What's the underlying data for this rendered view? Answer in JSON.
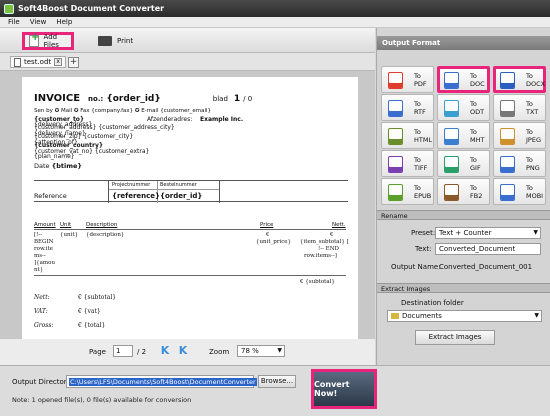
{
  "window": {
    "title": "Soft4Boost Document Converter"
  },
  "menu": [
    "File",
    "View",
    "Help"
  ],
  "toolbar": {
    "add_files": "Add Files",
    "print": "Print"
  },
  "tab": {
    "file_name": "test.odt",
    "close": "x",
    "add": "+"
  },
  "invoice": {
    "title": "INVOICE",
    "no_label": "no.:",
    "order_id": "{order_id}",
    "blad_label": "blad",
    "page_num": "1",
    "page_total": "/ 0",
    "sent_by": "Sen by ✪ Mail ✪ Fax {company.fax} ✪ E-mail {customer_email}",
    "customer_to": "{customer_to}",
    "customer_address_line": "{customer_address} {customer_address_city}",
    "customer_zip_line": "{customer_zip} {customer_city}",
    "customer_country": "{customer_country}",
    "customer_vat_line": "{customer_vat_no} {customer_extra}",
    "overlap_1": "{delivery_address}",
    "overlap_2": "{delivery_name}",
    "overlap_3": "{attention_of}",
    "overlap_4": "{plan_name}",
    "sender_label": "Afzenderadres:",
    "sender_value": "Example Inc.",
    "date_label": "Date",
    "date_value": "{btime}",
    "ref_col1": "Projectnummer",
    "ref_col2": "Bestelnummer",
    "ref_label": "Reference",
    "ref_val1": "{reference}",
    "ref_val2": "{order_id}",
    "col_amount": "Amount",
    "col_unit": "Unit",
    "col_desc": "Description",
    "col_price": "Price",
    "col_nett": "Nett.",
    "r_amount_1": "[!--",
    "r_amount_2": "BEGIN",
    "r_amount_3": "row.ite",
    "r_amount_4": "ms--",
    "r_amount_5": "]{amou",
    "r_amount_6": "nt}",
    "r_unit": "{unit}",
    "r_desc": "{description}",
    "r_price_sym": "€",
    "r_price": "{unit_price}",
    "r_nett_sym": "€",
    "r_nett": "{item_subtotal} [",
    "r_end_1": "!-- END",
    "r_end_2": "row.items--]",
    "subtotal_line": "€ {subtotal}",
    "nett_label": "Nett:",
    "nett_value": "€ {subtotal}",
    "vat_label": "VAT:",
    "vat_value": "€ {vat}",
    "gross_label": "Gross:",
    "gross_value": "€ {total}"
  },
  "pager": {
    "page_label": "Page",
    "page_value": "1",
    "of": "/ 2",
    "first": "K",
    "prev": "K",
    "zoom_label": "Zoom",
    "zoom_value": "78 %",
    "dropdown": "▼"
  },
  "output": {
    "label": "Output Directory:",
    "path": "C:\\Users\\LFS\\Documents\\Soft4Boost\\DocumentConverter",
    "browse": "Browse...",
    "convert": "Convert Now!",
    "status": "Note: 1 opened file(s), 0 file(s) available for conversion"
  },
  "formats": {
    "header": "Output Format",
    "to": "To",
    "items": [
      "PDF",
      "DOC",
      "DOCX",
      "RTF",
      "ODT",
      "TXT",
      "HTML",
      "MHT",
      "JPEG",
      "TIFF",
      "GIF",
      "PNG",
      "EPUB",
      "FB2",
      "MOBI"
    ],
    "icon_colors": [
      "#e03c2c",
      "#3a6fd0",
      "#2a5fc0",
      "#3a6fd0",
      "#3a9fd0",
      "#777777",
      "#6a8f2a",
      "#3a7fd0",
      "#cf8f2a",
      "#7a3fb0",
      "#2a9f6a",
      "#3a6fd0",
      "#5a9f2a",
      "#8a5a2a",
      "#3a6fd0"
    ]
  },
  "rename": {
    "header": "Rename",
    "preset_label": "Preset:",
    "preset_value": "Text + Counter",
    "text_label": "Text:",
    "text_value": "Converted_Document",
    "output_name_label": "Output Name:",
    "output_name_value": "Converted_Document_001"
  },
  "extract": {
    "header": "Extract Images",
    "dest_label": "Destination folder",
    "dest_value": "Documents",
    "button": "Extract Images"
  },
  "colors": {
    "highlight": "#e8257a",
    "accent": "#3a8fd8"
  }
}
